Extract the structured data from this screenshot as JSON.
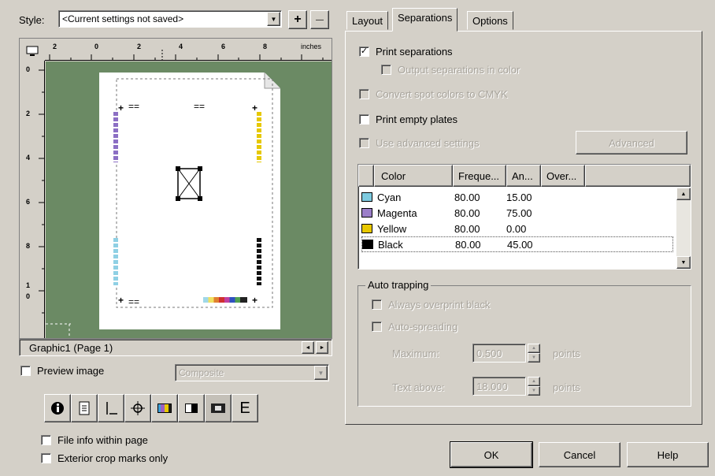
{
  "style": {
    "label": "Style:",
    "value": "<Current settings not saved>",
    "add_label": "+",
    "remove_label": "—"
  },
  "preview": {
    "ruler_unit": "inches",
    "top_ticks": [
      "2",
      "0",
      "2",
      "4",
      "6",
      "8"
    ],
    "left_ticks": [
      "0",
      "2",
      "4",
      "6",
      "8",
      "1",
      "0"
    ],
    "page_label": "Graphic1 (Page 1)",
    "preview_image_label": "Preview image",
    "preview_image_checked": false,
    "mode_value": "Composite",
    "file_info_label": "File info within page",
    "exterior_crop_label": "Exterior crop marks only",
    "toolbar_icons": [
      "info-icon",
      "page-icon",
      "crop-marks-icon",
      "registration-icon",
      "color-bars-icon",
      "densitometer-icon",
      "film-icon",
      "emulsion-icon"
    ]
  },
  "tabs": [
    "Layout",
    "Separations",
    "Options"
  ],
  "separations": {
    "print_separations_label": "Print separations",
    "print_separations_checked": true,
    "output_in_color_label": "Output separations in color",
    "convert_spot_label": "Convert spot colors to CMYK",
    "print_empty_label": "Print empty plates",
    "print_empty_checked": false,
    "advanced_settings_label": "Use advanced settings",
    "advanced_button": "Advanced",
    "table": {
      "headers": [
        "Color",
        "Freque...",
        "An...",
        "Over..."
      ],
      "rows": [
        {
          "name": "Cyan",
          "swatch": "#7ecbe0",
          "freq": "80.00",
          "angle": "15.00"
        },
        {
          "name": "Magenta",
          "swatch": "#9b7fc9",
          "freq": "80.00",
          "angle": "75.00"
        },
        {
          "name": "Yellow",
          "swatch": "#e8c800",
          "freq": "80.00",
          "angle": "0.00"
        },
        {
          "name": "Black",
          "swatch": "#000000",
          "freq": "80.00",
          "angle": "45.00"
        }
      ]
    },
    "auto_trapping": {
      "title": "Auto trapping",
      "overprint_label": "Always overprint black",
      "auto_spread_label": "Auto-spreading",
      "maximum_label": "Maximum:",
      "maximum_value": "0.500",
      "text_above_label": "Text above:",
      "text_above_value": "18.000",
      "unit": "points"
    }
  },
  "buttons": {
    "ok": "OK",
    "cancel": "Cancel",
    "help": "Help"
  }
}
